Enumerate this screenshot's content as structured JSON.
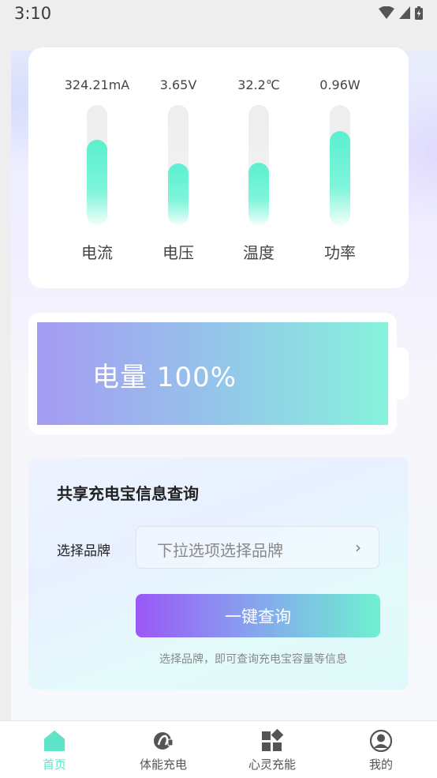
{
  "status_bar": {
    "time": "3:10"
  },
  "metrics": [
    {
      "value": "324.21mA",
      "label": "电流",
      "fill_fraction": 0.71
    },
    {
      "value": "3.65V",
      "label": "电压",
      "fill_fraction": 0.51
    },
    {
      "value": "32.2℃",
      "label": "温度",
      "fill_fraction": 0.52
    },
    {
      "value": "0.96W",
      "label": "功率",
      "fill_fraction": 0.78
    }
  ],
  "battery": {
    "label": "电量 100%",
    "level": 1.0
  },
  "query": {
    "title": "共享充电宝信息查询",
    "brand_label": "选择品牌",
    "brand_placeholder": "下拉选项选择品牌",
    "button_label": "一键查询",
    "hint": "选择品牌，即可查询充电宝容量等信息"
  },
  "nav": [
    {
      "label": "首页",
      "icon": "home-icon",
      "active": true
    },
    {
      "label": "体能充电",
      "icon": "fitness-icon",
      "active": false
    },
    {
      "label": "心灵充能",
      "icon": "grid-icon",
      "active": false
    },
    {
      "label": "我的",
      "icon": "user-icon",
      "active": false
    }
  ],
  "colors": {
    "accent": "#5fe3c9",
    "bar_fill": "#5af0cf",
    "button_start": "#9a58f7",
    "button_end": "#6ff1cf"
  }
}
